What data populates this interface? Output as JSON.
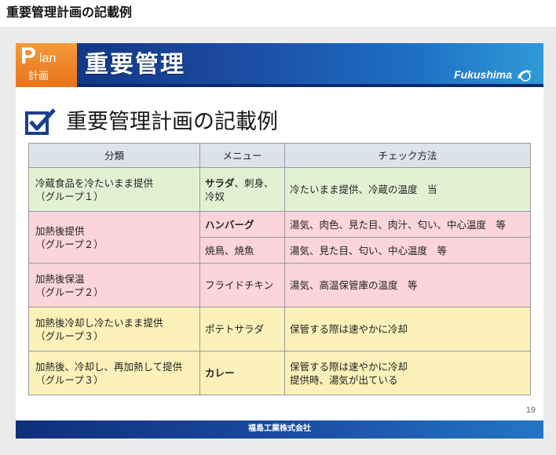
{
  "page": {
    "heading": "重要管理計画の記載例"
  },
  "banner": {
    "plan_letter": "P",
    "plan_rest": "lan",
    "plan_kanji": "計画",
    "title": "重要管理",
    "brand": "Fukushima"
  },
  "slide": {
    "title": "重要管理計画の記載例",
    "page_number": "19"
  },
  "table": {
    "headers": [
      "分類",
      "メニュー",
      "チェック方法"
    ],
    "rows": [
      {
        "category": "冷蔵食品を冷たいまま提供",
        "group": "（グループ１）",
        "menu_bold": "サラダ",
        "menu_rest": "、刺身、冷奴",
        "check": "冷たいまま提供、冷蔵の温度　当"
      },
      {
        "category": "加熱後提供",
        "group": "（グループ２）",
        "menu_bold": "ハンバーグ",
        "menu_rest": "",
        "check": "湯気、肉色、見た目、肉汁、匂い、中心温度　等"
      },
      {
        "menu_bold": "",
        "menu_rest": "焼鳥、焼魚",
        "check": "湯気、見た目、匂い、中心温度　等"
      },
      {
        "category": "加熱後保温",
        "group": "（グループ２）",
        "menu_bold": "",
        "menu_rest": "フライドチキン",
        "check": "湯気、高温保管庫の温度　等"
      },
      {
        "category": "加熱後冷却し冷たいまま提供",
        "group": "（グループ３）",
        "menu_bold": "",
        "menu_rest": "ポテトサラダ",
        "check": "保管する際は速やかに冷却"
      },
      {
        "category": "加熱後、冷却し、再加熱して提供",
        "group": "（グループ３）",
        "menu_bold": "カレー",
        "menu_rest": "",
        "check": "保管する際は速やかに冷却",
        "check2": "提供時、湯気が出ている"
      }
    ]
  },
  "footer": {
    "company": "福島工業株式会社"
  },
  "colors": {
    "banner": "#1b4aa0",
    "plan_orange": "#e8731a",
    "row_green": "#e3f1d3",
    "row_pink": "#fbd4dc",
    "row_yellow": "#fbf1b9",
    "header_gray": "#dde3ec"
  },
  "icons": {
    "title_icon": "checkbox-checked-icon",
    "brand_icon": "swoosh-icon"
  }
}
